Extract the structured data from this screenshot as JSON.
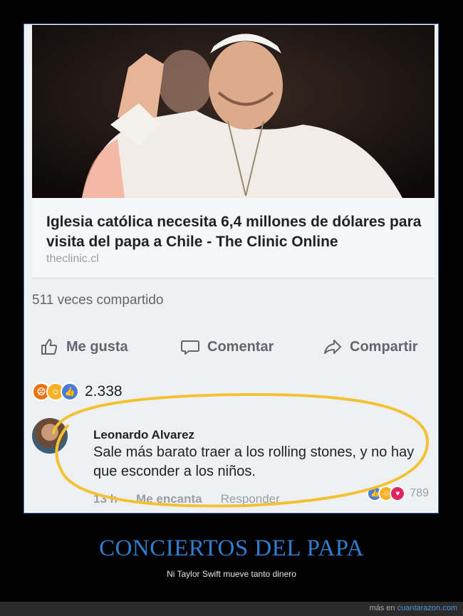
{
  "post": {
    "link_title": "Iglesia católica necesita 6,4 millones de dólares para visita del papa a Chile - The Clinic Online",
    "link_domain": "theclinic.cl",
    "shares": "511 veces compartido",
    "actions": {
      "like": "Me gusta",
      "comment": "Comentar",
      "share": "Compartir"
    },
    "reaction_count": "2.338"
  },
  "comment": {
    "author": "Leonardo Alvarez",
    "text": "Sale más barato traer a los rolling stones, y no hay que esconder a los niños.",
    "time": "13 h",
    "love_label": "Me encanta",
    "reply_label": "Responder",
    "reaction_count": "789"
  },
  "caption": {
    "title": "CONCIERTOS DEL PAPA",
    "subtitle": "Ni Taylor Swift mueve tanto dinero"
  },
  "footer": {
    "prefix": "más en",
    "site": "cuantarazon.com"
  },
  "colors": {
    "title": "#2f7fd0",
    "oval": "#f2c230",
    "frame": "#3f6fb0"
  }
}
